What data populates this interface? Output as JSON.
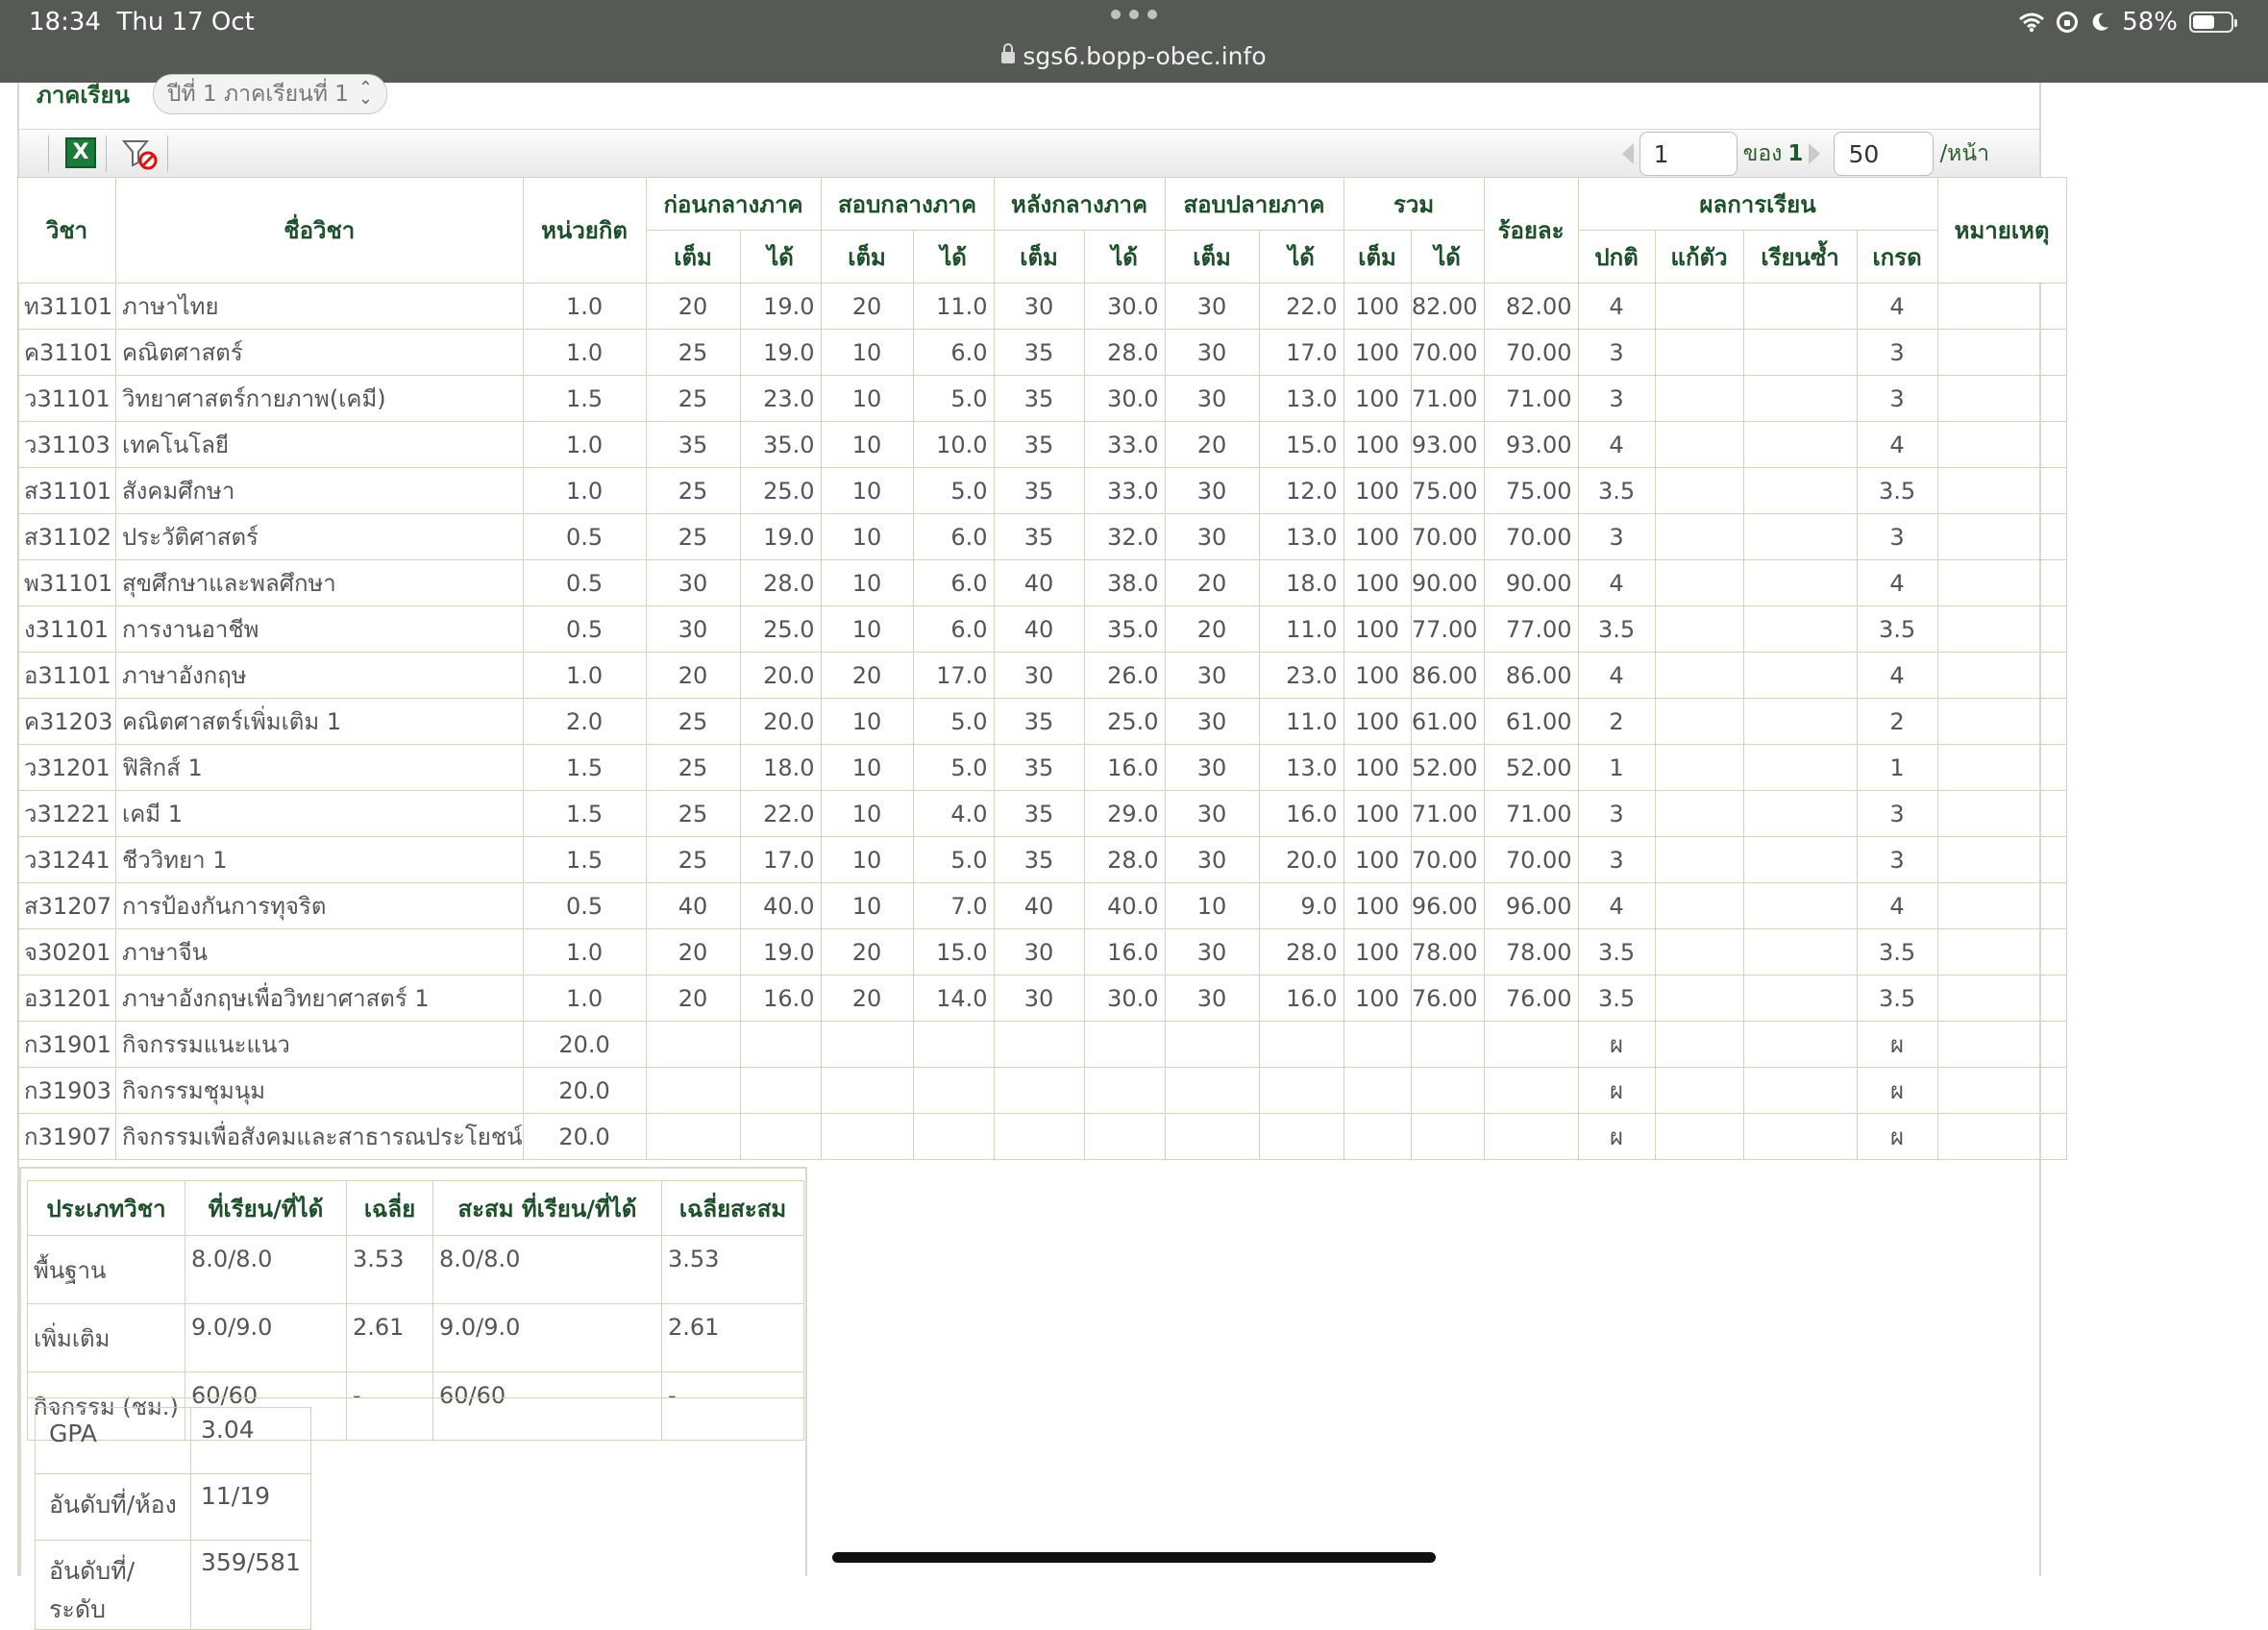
{
  "status_bar": {
    "time": "18:34",
    "date": "Thu 17 Oct",
    "url": "sgs6.bopp-obec.info",
    "battery": "58%",
    "battery_level": 0.58
  },
  "semester": {
    "label": "ภาคเรียน",
    "selected": "ปีที่ 1 ภาคเรียนที่ 1"
  },
  "pager": {
    "page": "1",
    "of_label": "ของ",
    "total_pages": "1",
    "page_size": "50",
    "per_page_label": "/หน้า"
  },
  "table": {
    "headers": {
      "code": "วิชา",
      "name": "ชื่อวิชา",
      "credit": "หน่วยกิต",
      "pre_mid": "ก่อนกลางภาค",
      "mid_exam": "สอบกลางภาค",
      "post_mid": "หลังกลางภาค",
      "final_exam": "สอบปลายภาค",
      "total": "รวม",
      "percent": "ร้อยละ",
      "result": "ผลการเรียน",
      "remark": "หมายเหตุ",
      "full": "เต็ม",
      "got": "ได้",
      "normal": "ปกติ",
      "fix": "แก้ตัว",
      "repeat": "เรียนซ้ำ",
      "grade": "เกรด"
    },
    "rows": [
      [
        "ท31101",
        "ภาษาไทย",
        "1.0",
        "20",
        "19.0",
        "20",
        "11.0",
        "30",
        "30.0",
        "30",
        "22.0",
        "100",
        "82.00",
        "82.00",
        "4",
        "",
        "",
        "4",
        ""
      ],
      [
        "ค31101",
        "คณิตศาสตร์",
        "1.0",
        "25",
        "19.0",
        "10",
        "6.0",
        "35",
        "28.0",
        "30",
        "17.0",
        "100",
        "70.00",
        "70.00",
        "3",
        "",
        "",
        "3",
        ""
      ],
      [
        "ว31101",
        "วิทยาศาสตร์กายภาพ(เคมี)",
        "1.5",
        "25",
        "23.0",
        "10",
        "5.0",
        "35",
        "30.0",
        "30",
        "13.0",
        "100",
        "71.00",
        "71.00",
        "3",
        "",
        "",
        "3",
        ""
      ],
      [
        "ว31103",
        "เทคโนโลยี",
        "1.0",
        "35",
        "35.0",
        "10",
        "10.0",
        "35",
        "33.0",
        "20",
        "15.0",
        "100",
        "93.00",
        "93.00",
        "4",
        "",
        "",
        "4",
        ""
      ],
      [
        "ส31101",
        "สังคมศึกษา",
        "1.0",
        "25",
        "25.0",
        "10",
        "5.0",
        "35",
        "33.0",
        "30",
        "12.0",
        "100",
        "75.00",
        "75.00",
        "3.5",
        "",
        "",
        "3.5",
        ""
      ],
      [
        "ส31102",
        "ประวัติศาสตร์",
        "0.5",
        "25",
        "19.0",
        "10",
        "6.0",
        "35",
        "32.0",
        "30",
        "13.0",
        "100",
        "70.00",
        "70.00",
        "3",
        "",
        "",
        "3",
        ""
      ],
      [
        "พ31101",
        "สุขศึกษาและพลศึกษา",
        "0.5",
        "30",
        "28.0",
        "10",
        "6.0",
        "40",
        "38.0",
        "20",
        "18.0",
        "100",
        "90.00",
        "90.00",
        "4",
        "",
        "",
        "4",
        ""
      ],
      [
        "ง31101",
        "การงานอาชีพ",
        "0.5",
        "30",
        "25.0",
        "10",
        "6.0",
        "40",
        "35.0",
        "20",
        "11.0",
        "100",
        "77.00",
        "77.00",
        "3.5",
        "",
        "",
        "3.5",
        ""
      ],
      [
        "อ31101",
        "ภาษาอังกฤษ",
        "1.0",
        "20",
        "20.0",
        "20",
        "17.0",
        "30",
        "26.0",
        "30",
        "23.0",
        "100",
        "86.00",
        "86.00",
        "4",
        "",
        "",
        "4",
        ""
      ],
      [
        "ค31203",
        "คณิตศาสตร์เพิ่มเติม 1",
        "2.0",
        "25",
        "20.0",
        "10",
        "5.0",
        "35",
        "25.0",
        "30",
        "11.0",
        "100",
        "61.00",
        "61.00",
        "2",
        "",
        "",
        "2",
        ""
      ],
      [
        "ว31201",
        "ฟิสิกส์ 1",
        "1.5",
        "25",
        "18.0",
        "10",
        "5.0",
        "35",
        "16.0",
        "30",
        "13.0",
        "100",
        "52.00",
        "52.00",
        "1",
        "",
        "",
        "1",
        ""
      ],
      [
        "ว31221",
        "เคมี 1",
        "1.5",
        "25",
        "22.0",
        "10",
        "4.0",
        "35",
        "29.0",
        "30",
        "16.0",
        "100",
        "71.00",
        "71.00",
        "3",
        "",
        "",
        "3",
        ""
      ],
      [
        "ว31241",
        "ชีววิทยา 1",
        "1.5",
        "25",
        "17.0",
        "10",
        "5.0",
        "35",
        "28.0",
        "30",
        "20.0",
        "100",
        "70.00",
        "70.00",
        "3",
        "",
        "",
        "3",
        ""
      ],
      [
        "ส31207",
        "การป้องกันการทุจริต",
        "0.5",
        "40",
        "40.0",
        "10",
        "7.0",
        "40",
        "40.0",
        "10",
        "9.0",
        "100",
        "96.00",
        "96.00",
        "4",
        "",
        "",
        "4",
        ""
      ],
      [
        "จ30201",
        "ภาษาจีน",
        "1.0",
        "20",
        "19.0",
        "20",
        "15.0",
        "30",
        "16.0",
        "30",
        "28.0",
        "100",
        "78.00",
        "78.00",
        "3.5",
        "",
        "",
        "3.5",
        ""
      ],
      [
        "อ31201",
        "ภาษาอังกฤษเพื่อวิทยาศาสตร์ 1",
        "1.0",
        "20",
        "16.0",
        "20",
        "14.0",
        "30",
        "30.0",
        "30",
        "16.0",
        "100",
        "76.00",
        "76.00",
        "3.5",
        "",
        "",
        "3.5",
        ""
      ],
      [
        "ก31901",
        "กิจกรรมแนะแนว",
        "20.0",
        "",
        "",
        "",
        "",
        "",
        "",
        "",
        "",
        "",
        "",
        "",
        "ผ",
        "",
        "",
        "ผ",
        ""
      ],
      [
        "ก31903",
        "กิจกรรมชุมนุม",
        "20.0",
        "",
        "",
        "",
        "",
        "",
        "",
        "",
        "",
        "",
        "",
        "",
        "ผ",
        "",
        "",
        "ผ",
        ""
      ],
      [
        "ก31907",
        "กิจกรรมเพื่อสังคมและสาธารณประโยชน์",
        "20.0",
        "",
        "",
        "",
        "",
        "",
        "",
        "",
        "",
        "",
        "",
        "",
        "ผ",
        "",
        "",
        "ผ",
        ""
      ]
    ]
  },
  "summary": {
    "headers": [
      "ประเภทวิชา",
      "ที่เรียน/ที่ได้",
      "เฉลี่ย",
      "สะสม ที่เรียน/ที่ได้",
      "เฉลี่ยสะสม"
    ],
    "rows": [
      [
        "พื้นฐาน",
        "8.0/8.0",
        "3.53",
        "8.0/8.0",
        "3.53"
      ],
      [
        "เพิ่มเติม",
        "9.0/9.0",
        "2.61",
        "9.0/9.0",
        "2.61"
      ],
      [
        "กิจกรรม (ชม.)",
        "60/60",
        "-",
        "60/60",
        "-"
      ]
    ]
  },
  "gpa": {
    "rows": [
      [
        "GPA",
        "3.04"
      ],
      [
        "อันดับที่/ห้อง",
        "11/19"
      ],
      [
        "อันดับที่/ระดับ",
        "359/581"
      ]
    ]
  },
  "colors": {
    "header_text": "#1d4f2a",
    "grid": "#c9d8b6",
    "status_bar": "#555a55"
  },
  "icons": [
    "wifi-icon",
    "rotation-lock-icon",
    "moon-icon",
    "battery-icon",
    "lock-icon",
    "excel-export-icon",
    "filter-clear-icon",
    "chevron-updown-icon"
  ]
}
